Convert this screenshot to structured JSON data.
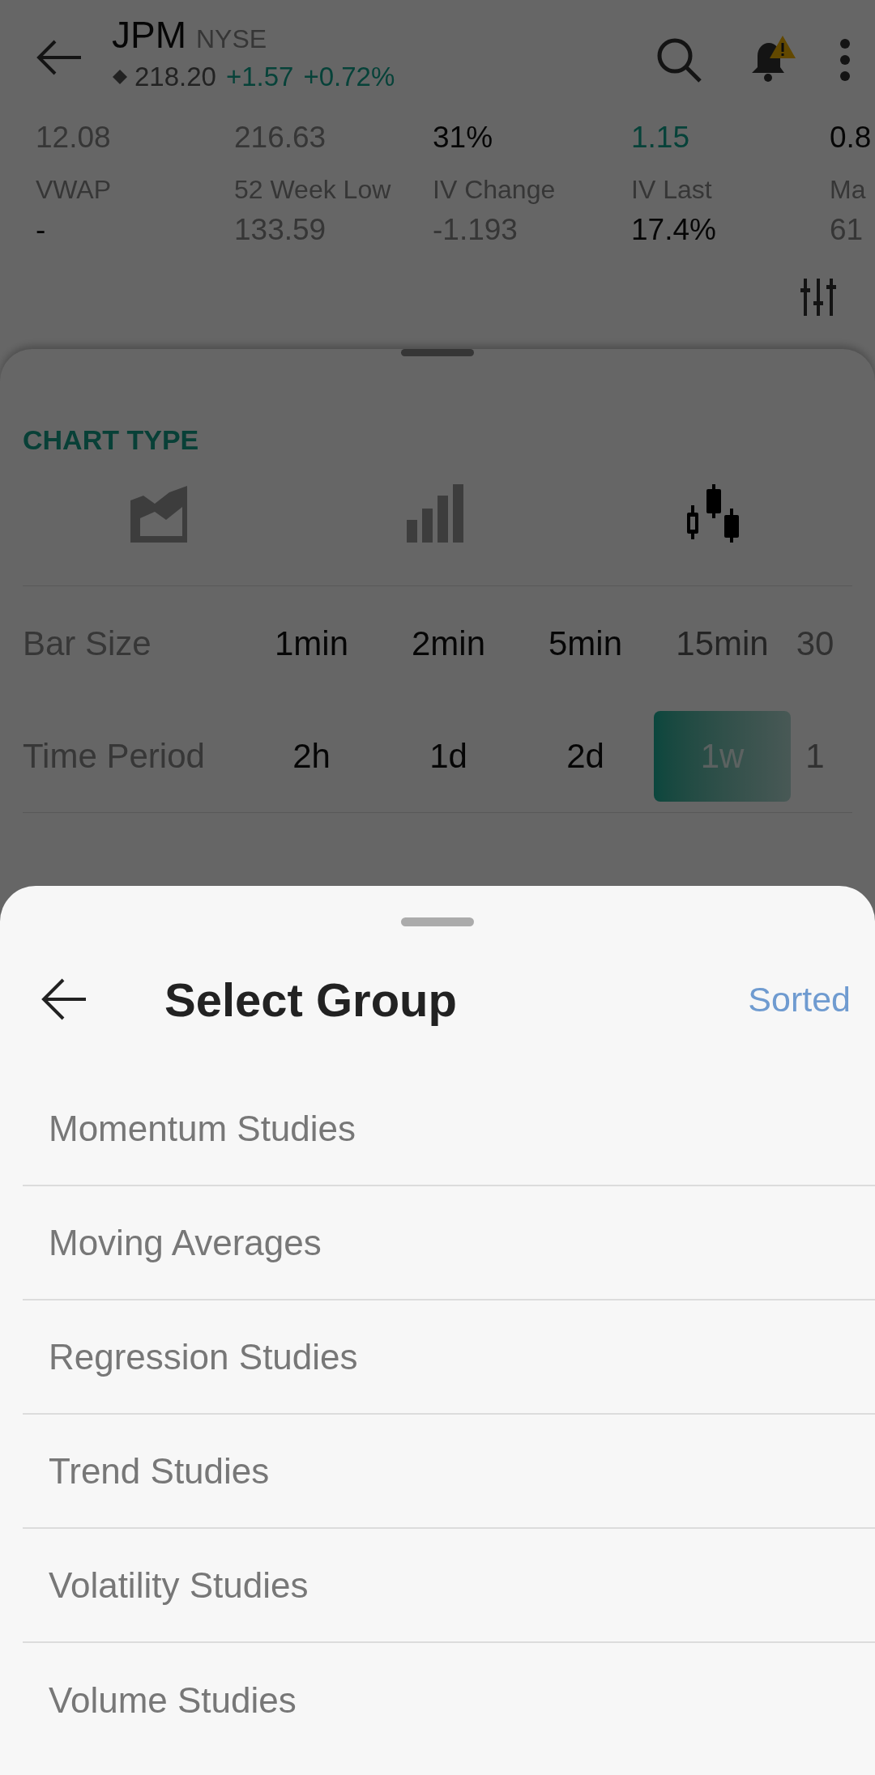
{
  "header": {
    "symbol": "JPM",
    "exchange": "NYSE",
    "price": "218.20",
    "change": "+1.57",
    "change_percent": "+0.72%"
  },
  "stats_top": [
    {
      "value": "12.08",
      "kind": "muted"
    },
    {
      "value": "216.63",
      "kind": "muted"
    },
    {
      "value": "31%",
      "kind": "strong"
    },
    {
      "value": "1.15",
      "kind": "up"
    },
    {
      "value": "0.8",
      "kind": "strong"
    }
  ],
  "stats": [
    {
      "label": "VWAP",
      "value": "-",
      "kind": "strong"
    },
    {
      "label": "52 Week Low",
      "value": "133.59",
      "kind": "muted"
    },
    {
      "label": "IV Change",
      "value": "-1.193",
      "kind": "muted"
    },
    {
      "label": "IV Last",
      "value": "17.4%",
      "kind": "strong"
    },
    {
      "label": "Ma",
      "value": "61",
      "kind": "muted"
    }
  ],
  "chart_settings": {
    "section_title": "CHART TYPE",
    "chart_types": [
      {
        "kind": "area",
        "selected": false
      },
      {
        "kind": "bar",
        "selected": false
      },
      {
        "kind": "candlestick",
        "selected": true
      }
    ],
    "bar_size": {
      "label": "Bar Size",
      "options": [
        {
          "label": "1min",
          "selected": false
        },
        {
          "label": "2min",
          "selected": false
        },
        {
          "label": "5min",
          "selected": false
        },
        {
          "label": "15min",
          "selected": false
        },
        {
          "label": "30",
          "selected": false
        }
      ]
    },
    "time_period": {
      "label": "Time Period",
      "options": [
        {
          "label": "2h",
          "selected": false
        },
        {
          "label": "1d",
          "selected": false
        },
        {
          "label": "2d",
          "selected": false
        },
        {
          "label": "1w",
          "selected": true
        },
        {
          "label": "1",
          "selected": false
        }
      ]
    }
  },
  "group_sheet": {
    "title": "Select Group",
    "action": "Sorted",
    "groups": [
      "Momentum Studies",
      "Moving Averages",
      "Regression Studies",
      "Trend Studies",
      "Volatility Studies",
      "Volume Studies"
    ]
  }
}
